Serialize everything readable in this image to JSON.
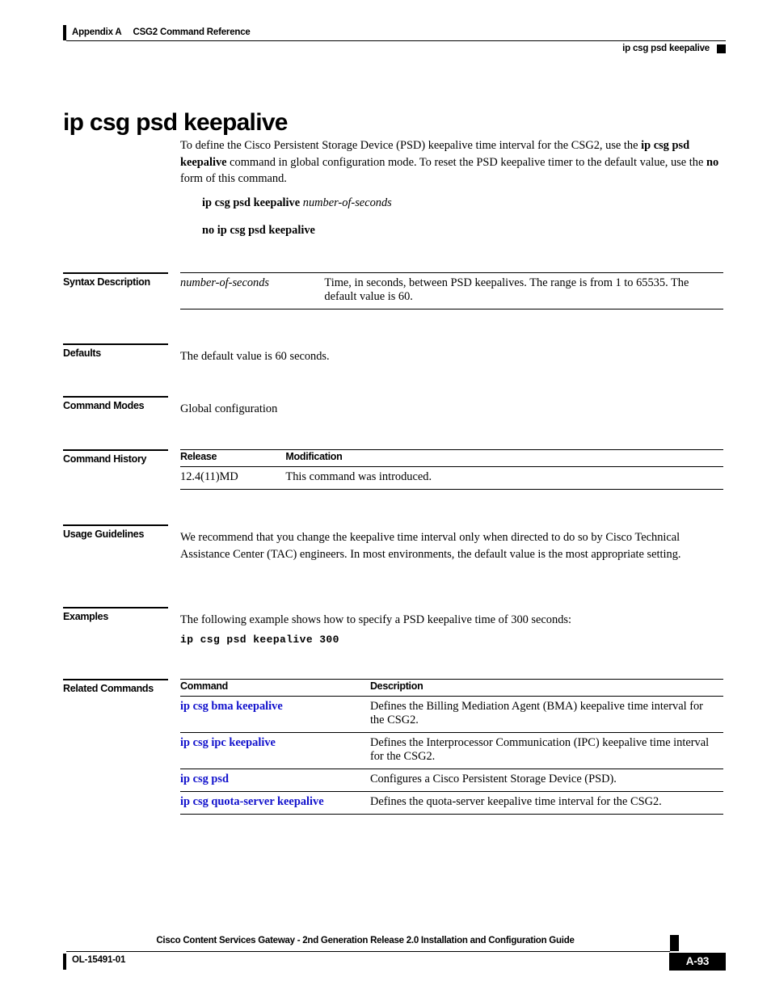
{
  "header": {
    "appendix": "Appendix A",
    "chapter": "CSG2 Command Reference",
    "running_command": "ip csg psd keepalive"
  },
  "title": "ip csg psd keepalive",
  "intro": {
    "part1": "To define the Cisco Persistent Storage Device (PSD) keepalive time interval for the CSG2, use the ",
    "bold1": "ip csg psd keepalive",
    "part2": " command in global configuration mode. To reset the PSD keepalive timer to the default value, use the ",
    "bold2": "no",
    "part3": " form of this command."
  },
  "syntax": {
    "command_bold": "ip csg psd keepalive",
    "command_arg": "number-of-seconds",
    "no_form": "no ip csg psd keepalive"
  },
  "sections": {
    "syntax_description": "Syntax Description",
    "defaults": "Defaults",
    "command_modes": "Command Modes",
    "command_history": "Command History",
    "usage_guidelines": "Usage Guidelines",
    "examples": "Examples",
    "related_commands": "Related Commands"
  },
  "syntax_description_table": {
    "rows": [
      {
        "parameter": "number-of-seconds",
        "description": "Time, in seconds, between PSD keepalives. The range is from 1 to 65535. The default value is 60."
      }
    ]
  },
  "defaults_text": "The default value is 60 seconds.",
  "command_modes_text": "Global configuration",
  "command_history_table": {
    "headers": [
      "Release",
      "Modification"
    ],
    "rows": [
      {
        "release": "12.4(11)MD",
        "modification": "This command was introduced."
      }
    ]
  },
  "usage_guidelines_text": "We recommend that you change the keepalive time interval only when directed to do so by Cisco Technical Assistance Center (TAC) engineers. In most environments, the default value is the most appropriate setting.",
  "examples": {
    "intro": "The following example shows how to specify a PSD keepalive time of 300 seconds:",
    "code": "ip csg psd keepalive 300"
  },
  "related_commands_table": {
    "headers": [
      "Command",
      "Description"
    ],
    "rows": [
      {
        "command": "ip csg bma keepalive",
        "description": "Defines the Billing Mediation Agent (BMA) keepalive time interval for the CSG2."
      },
      {
        "command": "ip csg ipc keepalive",
        "description": "Defines the Interprocessor Communication (IPC) keepalive time interval for the CSG2."
      },
      {
        "command": "ip csg psd",
        "description": "Configures a Cisco Persistent Storage Device (PSD)."
      },
      {
        "command": "ip csg quota-server keepalive",
        "description": "Defines the quota-server keepalive time interval for the CSG2."
      }
    ]
  },
  "footer": {
    "guide_title": "Cisco Content Services Gateway - 2nd Generation Release 2.0 Installation and Configuration Guide",
    "doc_id": "OL-15491-01",
    "page_number": "A-93"
  },
  "colors": {
    "link": "#1111cc",
    "rule": "#000000",
    "text": "#000000"
  }
}
